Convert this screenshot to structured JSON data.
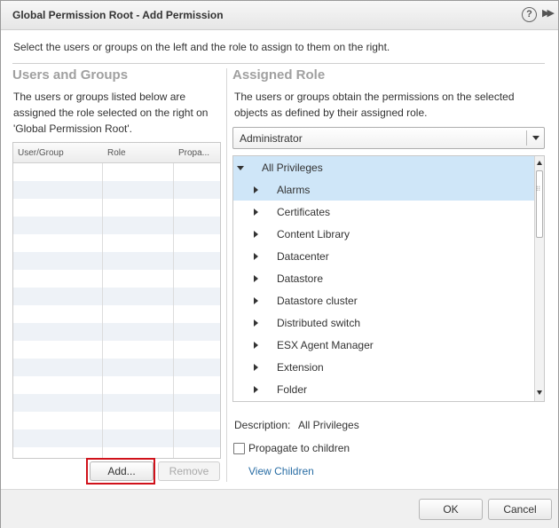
{
  "window": {
    "title": "Global Permission Root - Add Permission"
  },
  "icons": {
    "help": "?",
    "expand": "▶▶"
  },
  "instructions": "Select the users or groups on the left and the role to assign to them on the right.",
  "users_groups": {
    "heading": "Users and Groups",
    "description": "The users or groups listed below are assigned the role selected on the right on 'Global Permission Root'.",
    "columns": [
      "User/Group",
      "Role",
      "Propa..."
    ],
    "add_label": "Add...",
    "remove_label": "Remove"
  },
  "assigned_role": {
    "heading": "Assigned Role",
    "description": "The users or groups obtain the permissions on the selected objects as defined by their assigned role.",
    "selected_role": "Administrator",
    "tree": [
      {
        "label": "All Privileges",
        "expanded": true,
        "selected": true
      },
      {
        "label": "Alarms",
        "expanded": false,
        "selected": true
      },
      {
        "label": "Certificates",
        "expanded": false,
        "selected": false
      },
      {
        "label": "Content Library",
        "expanded": false,
        "selected": false
      },
      {
        "label": "Datacenter",
        "expanded": false,
        "selected": false
      },
      {
        "label": "Datastore",
        "expanded": false,
        "selected": false
      },
      {
        "label": "Datastore cluster",
        "expanded": false,
        "selected": false
      },
      {
        "label": "Distributed switch",
        "expanded": false,
        "selected": false
      },
      {
        "label": "ESX Agent Manager",
        "expanded": false,
        "selected": false
      },
      {
        "label": "Extension",
        "expanded": false,
        "selected": false
      },
      {
        "label": "Folder",
        "expanded": false,
        "selected": false
      }
    ],
    "description_label": "Description:",
    "description_value": "All Privileges",
    "propagate_label": "Propagate to children",
    "propagate_checked": false,
    "view_children_label": "View Children"
  },
  "footer": {
    "ok_label": "OK",
    "cancel_label": "Cancel"
  },
  "colors": {
    "selection": "#cfe6f8",
    "link": "#2a6ea5",
    "highlight_box": "#d0121b"
  }
}
